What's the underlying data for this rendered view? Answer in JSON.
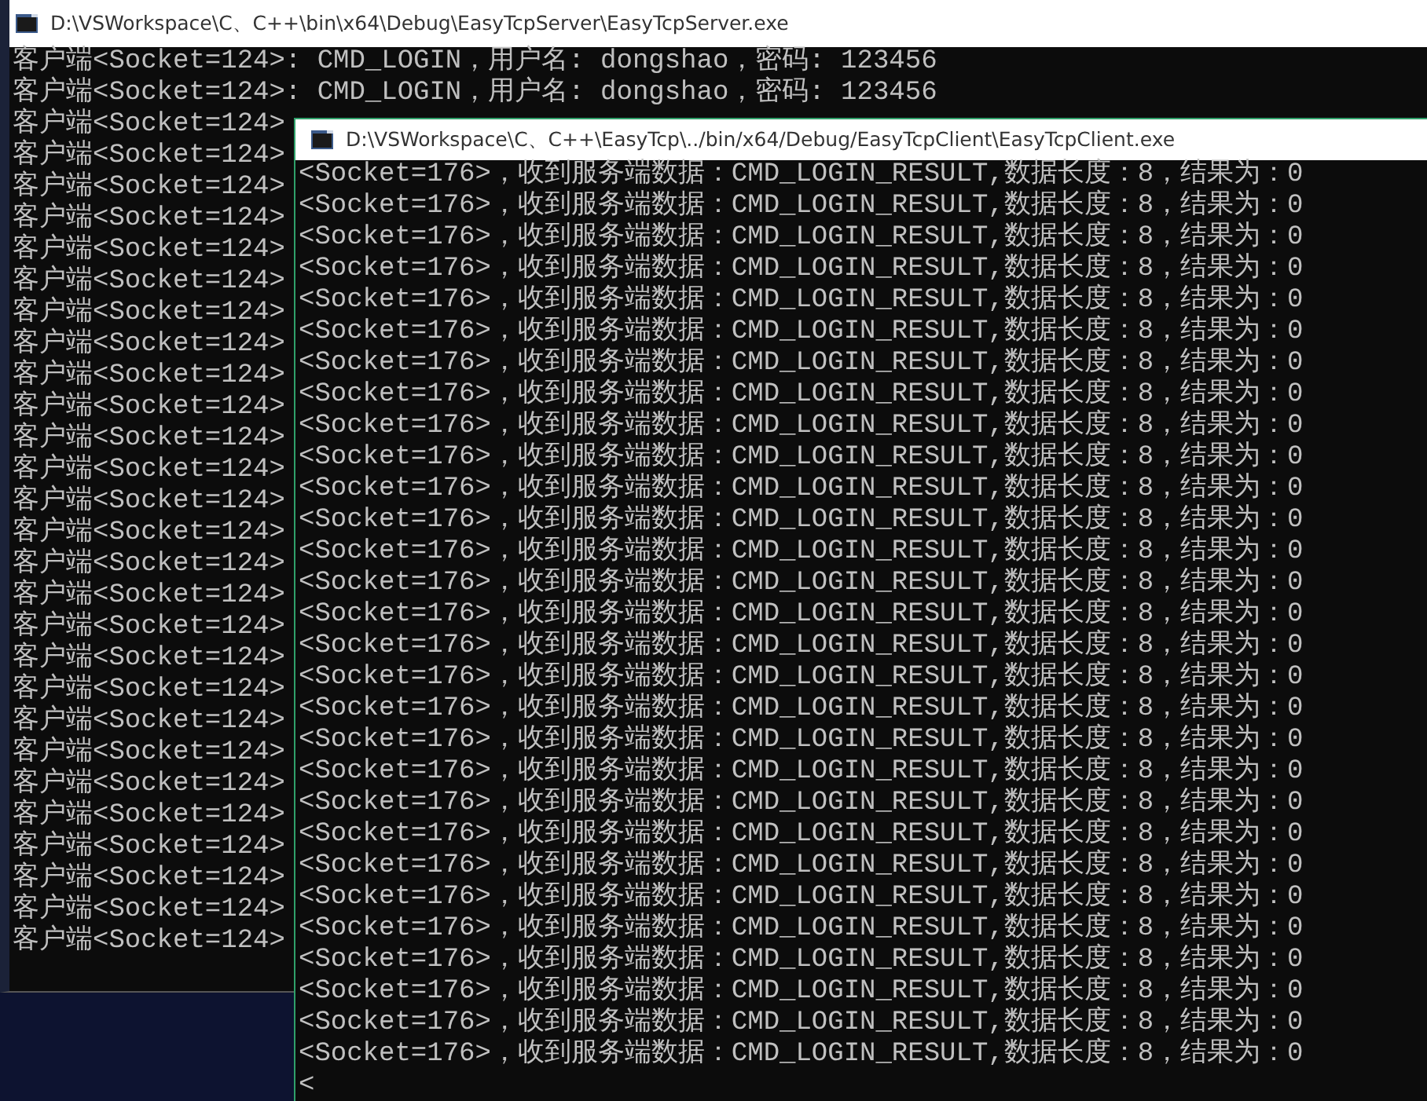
{
  "server_window": {
    "title": "D:\\VSWorkspace\\C、C++\\bin\\x64\\Debug\\EasyTcpServer\\EasyTcpServer.exe",
    "lines": [
      "客户端<Socket=124>: CMD_LOGIN，用户名: dongshao，密码: 123456",
      "客户端<Socket=124>: CMD_LOGIN，用户名: dongshao，密码: 123456",
      "客户端<Socket=124>",
      "客户端<Socket=124>",
      "客户端<Socket=124>",
      "客户端<Socket=124>",
      "客户端<Socket=124>",
      "客户端<Socket=124>",
      "客户端<Socket=124>",
      "客户端<Socket=124>",
      "客户端<Socket=124>",
      "客户端<Socket=124>",
      "客户端<Socket=124>",
      "客户端<Socket=124>",
      "客户端<Socket=124>",
      "客户端<Socket=124>",
      "客户端<Socket=124>",
      "客户端<Socket=124>",
      "客户端<Socket=124>",
      "客户端<Socket=124>",
      "客户端<Socket=124>",
      "客户端<Socket=124>",
      "客户端<Socket=124>",
      "客户端<Socket=124>",
      "客户端<Socket=124>",
      "客户端<Socket=124>",
      "客户端<Socket=124>",
      "客户端<Socket=124>",
      "客户端<Socket=124>"
    ]
  },
  "client_window": {
    "title": "D:\\VSWorkspace\\C、C++\\EasyTcp\\../bin/x64/Debug/EasyTcpClient\\EasyTcpClient.exe",
    "lines": [
      "<Socket=176>，收到服务端数据：CMD_LOGIN_RESULT,数据长度：8，结果为：0",
      "<Socket=176>，收到服务端数据：CMD_LOGIN_RESULT,数据长度：8，结果为：0",
      "<Socket=176>，收到服务端数据：CMD_LOGIN_RESULT,数据长度：8，结果为：0",
      "<Socket=176>，收到服务端数据：CMD_LOGIN_RESULT,数据长度：8，结果为：0",
      "<Socket=176>，收到服务端数据：CMD_LOGIN_RESULT,数据长度：8，结果为：0",
      "<Socket=176>，收到服务端数据：CMD_LOGIN_RESULT,数据长度：8，结果为：0",
      "<Socket=176>，收到服务端数据：CMD_LOGIN_RESULT,数据长度：8，结果为：0",
      "<Socket=176>，收到服务端数据：CMD_LOGIN_RESULT,数据长度：8，结果为：0",
      "<Socket=176>，收到服务端数据：CMD_LOGIN_RESULT,数据长度：8，结果为：0",
      "<Socket=176>，收到服务端数据：CMD_LOGIN_RESULT,数据长度：8，结果为：0",
      "<Socket=176>，收到服务端数据：CMD_LOGIN_RESULT,数据长度：8，结果为：0",
      "<Socket=176>，收到服务端数据：CMD_LOGIN_RESULT,数据长度：8，结果为：0",
      "<Socket=176>，收到服务端数据：CMD_LOGIN_RESULT,数据长度：8，结果为：0",
      "<Socket=176>，收到服务端数据：CMD_LOGIN_RESULT,数据长度：8，结果为：0",
      "<Socket=176>，收到服务端数据：CMD_LOGIN_RESULT,数据长度：8，结果为：0",
      "<Socket=176>，收到服务端数据：CMD_LOGIN_RESULT,数据长度：8，结果为：0",
      "<Socket=176>，收到服务端数据：CMD_LOGIN_RESULT,数据长度：8，结果为：0",
      "<Socket=176>，收到服务端数据：CMD_LOGIN_RESULT,数据长度：8，结果为：0",
      "<Socket=176>，收到服务端数据：CMD_LOGIN_RESULT,数据长度：8，结果为：0",
      "<Socket=176>，收到服务端数据：CMD_LOGIN_RESULT,数据长度：8，结果为：0",
      "<Socket=176>，收到服务端数据：CMD_LOGIN_RESULT,数据长度：8，结果为：0",
      "<Socket=176>，收到服务端数据：CMD_LOGIN_RESULT,数据长度：8，结果为：0",
      "<Socket=176>，收到服务端数据：CMD_LOGIN_RESULT,数据长度：8，结果为：0",
      "<Socket=176>，收到服务端数据：CMD_LOGIN_RESULT,数据长度：8，结果为：0",
      "<Socket=176>，收到服务端数据：CMD_LOGIN_RESULT,数据长度：8，结果为：0",
      "<Socket=176>，收到服务端数据：CMD_LOGIN_RESULT,数据长度：8，结果为：0",
      "<Socket=176>，收到服务端数据：CMD_LOGIN_RESULT,数据长度：8，结果为：0",
      "<Socket=176>，收到服务端数据：CMD_LOGIN_RESULT,数据长度：8，结果为：0",
      "<Socket=176>，收到服务端数据：CMD_LOGIN_RESULT,数据长度：8，结果为：0",
      "<"
    ]
  }
}
